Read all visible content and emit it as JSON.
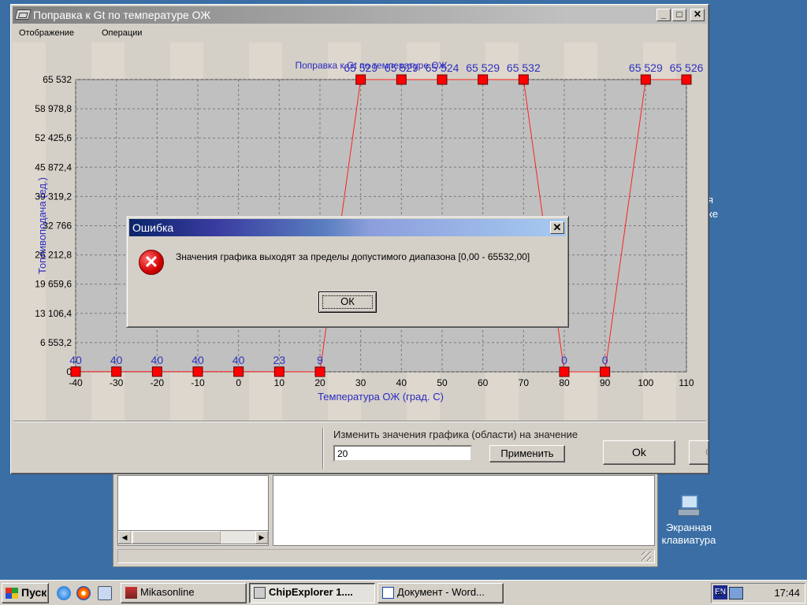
{
  "main_window": {
    "title": "Поправка к Gt по температуре ОЖ",
    "menu": [
      "Отображение",
      "Операции"
    ]
  },
  "chart_data": {
    "type": "line",
    "title": "Поправка к Gt по температуре ОЖ",
    "xlabel": "Температура ОЖ (град. С)",
    "ylabel": "Топливоподача (ед.)",
    "x": [
      -40,
      -30,
      -20,
      -10,
      0,
      10,
      20,
      30,
      40,
      50,
      60,
      70,
      80,
      90,
      100,
      110
    ],
    "values": [
      40,
      40,
      40,
      40,
      40,
      23,
      9,
      65529,
      65529,
      65524,
      65529,
      65532,
      0,
      0,
      65529,
      65526
    ],
    "point_labels": [
      "40",
      "40",
      "40",
      "40",
      "40",
      "23",
      "9",
      "65 529",
      "65 529",
      "65 524",
      "65 529",
      "65 532",
      "0",
      "0",
      "65 529",
      "65 526"
    ],
    "y_ticks": [
      "0",
      "6 553,2",
      "13 106,4",
      "19 659,6",
      "26 212,8",
      "32 766",
      "39 319,2",
      "45 872,4",
      "52 425,6",
      "58 978,8",
      "65 532"
    ],
    "x_ticks": [
      "-40",
      "-30",
      "-20",
      "-10",
      "0",
      "10",
      "20",
      "30",
      "40",
      "50",
      "60",
      "70",
      "80",
      "90",
      "100",
      "110"
    ],
    "ylim": [
      0,
      65532
    ],
    "xlim": [
      -40,
      110
    ],
    "grid": true,
    "colors": {
      "line": "#ff2020",
      "marker": "#ff0000",
      "label": "#3030c0",
      "plot_bg": "#c0c0c0"
    }
  },
  "edit_panel": {
    "label": "Изменить значения графика (области) на значение",
    "value": "20",
    "apply_label": "Применить",
    "ok_label": "Ok",
    "cancel_label_partial": "О"
  },
  "error_dialog": {
    "title": "Ошибка",
    "message": "Значения графика выходят за пределы допустимого диапазона [0,00 - 65532,00]",
    "ok_label": "ОК",
    "icon": "error-icon"
  },
  "desktop": {
    "icon_label_line1": "Экранная",
    "icon_label_line2": "клавиатура",
    "partial_text_1": "я",
    "partial_text_2": "ке"
  },
  "taskbar": {
    "start_label": "Пуск",
    "tasks": [
      {
        "label": "Mikasonline"
      },
      {
        "label": "ChipExplorer 1...."
      },
      {
        "label": "Документ - Word..."
      }
    ],
    "language": "EN",
    "clock": "17:44"
  }
}
